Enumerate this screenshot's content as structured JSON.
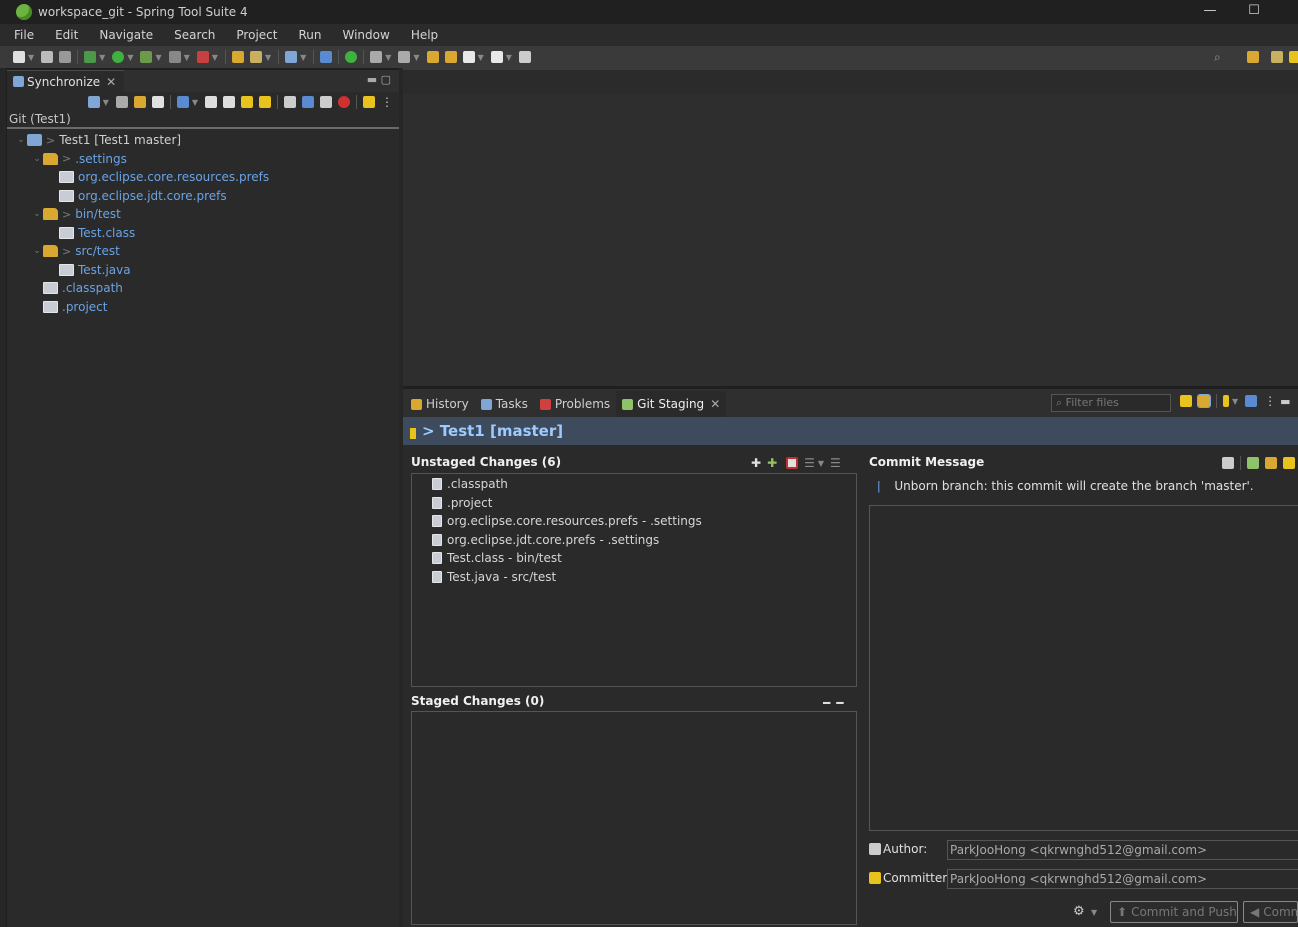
{
  "window": {
    "title": "workspace_git - Spring Tool Suite 4",
    "minimize_glyph": "—",
    "maximize_glyph": "☐"
  },
  "menubar": {
    "items": [
      "File",
      "Edit",
      "Navigate",
      "Search",
      "Project",
      "Run",
      "Window",
      "Help"
    ]
  },
  "sync_view": {
    "tab_label": "Synchronize",
    "breadcrumb": "Git (Test1)",
    "tree": [
      {
        "label": "Test1 [Test1 master]",
        "prefix": ">",
        "indent": 0,
        "kind": "project",
        "color": "plain"
      },
      {
        "label": ".settings",
        "prefix": ">",
        "indent": 1,
        "kind": "folder",
        "color": "blue"
      },
      {
        "label": "org.eclipse.core.resources.prefs",
        "prefix": "",
        "indent": 2,
        "kind": "file",
        "color": "blue"
      },
      {
        "label": "org.eclipse.jdt.core.prefs",
        "prefix": "",
        "indent": 2,
        "kind": "file",
        "color": "blue"
      },
      {
        "label": "bin/test",
        "prefix": ">",
        "indent": 1,
        "kind": "folder",
        "color": "blue"
      },
      {
        "label": "Test.class",
        "prefix": "",
        "indent": 2,
        "kind": "file",
        "color": "blue"
      },
      {
        "label": "src/test",
        "prefix": ">",
        "indent": 1,
        "kind": "folder",
        "color": "blue"
      },
      {
        "label": "Test.java",
        "prefix": "",
        "indent": 2,
        "kind": "file",
        "color": "blue"
      },
      {
        "label": ".classpath",
        "prefix": "",
        "indent": 1,
        "kind": "file",
        "color": "blue"
      },
      {
        "label": ".project",
        "prefix": "",
        "indent": 1,
        "kind": "file",
        "color": "blue"
      }
    ]
  },
  "bottom_panel": {
    "tabs": [
      {
        "label": "History",
        "active": false,
        "icon_color": "#d9a830"
      },
      {
        "label": "Tasks",
        "active": false,
        "icon_color": "#7fa6d4"
      },
      {
        "label": "Problems",
        "active": false,
        "icon_color": "#d04040"
      },
      {
        "label": "Git Staging",
        "active": true,
        "icon_color": "#8fc36a"
      }
    ],
    "filter_placeholder": "Filter files"
  },
  "staging": {
    "repo_title": "> Test1 [master]",
    "unstaged_header": "Unstaged Changes (6)",
    "unstaged_files": [
      ".classpath",
      ".project",
      "org.eclipse.core.resources.prefs - .settings",
      "org.eclipse.jdt.core.prefs - .settings",
      "Test.class - bin/test",
      "Test.java - src/test"
    ],
    "staged_header": "Staged Changes (0)",
    "staged_files": [],
    "commit_header": "Commit Message",
    "commit_info": "Unborn branch: this commit will create the branch 'master'.",
    "commit_message": "",
    "author_label": "Author:",
    "author_value": "ParkJooHong <qkrwnghd512@gmail.com>",
    "committer_label": "Committer:",
    "committer_value": "ParkJooHong <qkrwnghd512@gmail.com>",
    "commit_push_label": "Commit and Push",
    "commit_label": "Comm"
  },
  "colors": {
    "accent_blue": "#6aa3e6",
    "repo_header_bg": "#3d4b5c",
    "repo_title": "#9ecbff"
  }
}
